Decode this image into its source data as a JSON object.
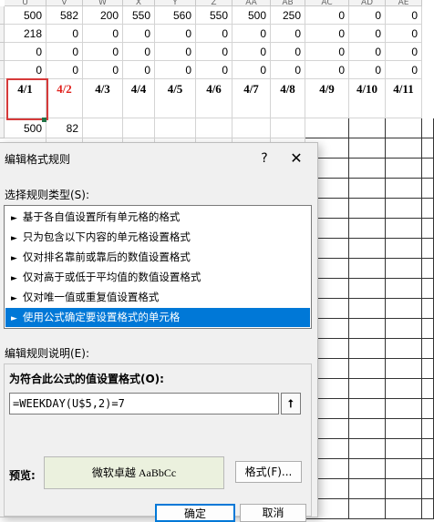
{
  "sheet": {
    "columns": [
      "U",
      "V",
      "W",
      "X",
      "Y",
      "Z",
      "AA",
      "AB",
      "AC",
      "AD",
      "AE"
    ],
    "rows": [
      [
        "500",
        "582",
        "200",
        "550",
        "560",
        "550",
        "500",
        "250",
        "0",
        "0",
        "0"
      ],
      [
        "218",
        "0",
        "0",
        "0",
        "0",
        "0",
        "0",
        "0",
        "0",
        "0",
        "0"
      ],
      [
        "0",
        "0",
        "0",
        "0",
        "0",
        "0",
        "0",
        "0",
        "0",
        "0",
        "0"
      ],
      [
        "0",
        "0",
        "0",
        "0",
        "0",
        "0",
        "0",
        "0",
        "0",
        "0",
        "0"
      ]
    ],
    "dates": [
      "4/1",
      "4/2",
      "4/3",
      "4/4",
      "4/5",
      "4/6",
      "4/7",
      "4/8",
      "4/9",
      "4/10",
      "4/11"
    ],
    "after_row": [
      "500",
      "82"
    ],
    "highlight_color": "#e0201c"
  },
  "dialog": {
    "title": "编辑格式规则",
    "help_label": "?",
    "close_label": "✕",
    "select_type_label": "选择规则类型(S):",
    "rule_types": [
      {
        "label": "基于各自值设置所有单元格的格式",
        "selected": false
      },
      {
        "label": "只为包含以下内容的单元格设置格式",
        "selected": false
      },
      {
        "label": "仅对排名靠前或靠后的数值设置格式",
        "selected": false
      },
      {
        "label": "仅对高于或低于平均值的数值设置格式",
        "selected": false
      },
      {
        "label": "仅对唯一值或重复值设置格式",
        "selected": false
      },
      {
        "label": "使用公式确定要设置格式的单元格",
        "selected": true
      }
    ],
    "arrow_glyph": "►",
    "edit_desc_label": "编辑规则说明(E):",
    "formula_label": "为符合此公式的值设置格式(O):",
    "formula_value": "=WEEKDAY(U$5,2)=7",
    "collapse_icon_glyph": "⭡",
    "preview_label": "预览:",
    "preview_text": "微软卓越  AaBbCc",
    "preview_bg": "#ebf1de",
    "format_button": "格式(F)...",
    "ok_button": "确定",
    "cancel_button": "取消",
    "accent_color": "#0078d7"
  }
}
